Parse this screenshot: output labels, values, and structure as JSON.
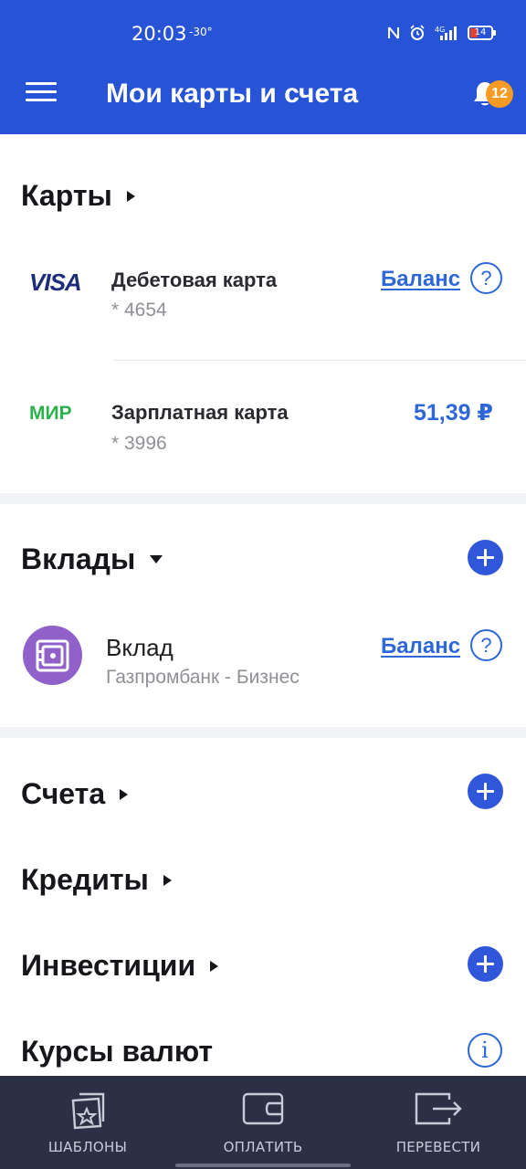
{
  "status_bar": {
    "time": "20:03",
    "temperature": "-30°",
    "battery": "14"
  },
  "header": {
    "title": "Мои карты и счета",
    "notifications_count": "12"
  },
  "cards_section": {
    "title": "Карты",
    "items": [
      {
        "brand": "VISA",
        "name": "Дебетовая карта",
        "number": "* 4654",
        "balance_link": "Баланс",
        "help": "?"
      },
      {
        "brand": "МИР",
        "name": "Зарплатная карта",
        "number": "* 3996",
        "amount": "51,39 ₽"
      }
    ]
  },
  "deposits_section": {
    "title": "Вклады",
    "items": [
      {
        "name": "Вклад",
        "bank": "Газпромбанк - Бизнес",
        "balance_link": "Баланс",
        "help": "?"
      }
    ]
  },
  "other_sections": {
    "accounts": "Счета",
    "credits": "Кредиты",
    "investments": "Инвестиции",
    "currency_rates": "Курсы валют",
    "info_symbol": "i"
  },
  "bottom_nav": {
    "templates": "ШАБЛОНЫ",
    "pay": "ОПЛАТИТЬ",
    "transfer": "ПЕРЕВЕСТИ"
  },
  "colors": {
    "primary": "#2754d6",
    "link": "#2d67d8",
    "badge": "#f59a23",
    "nav_bg": "#2b3045",
    "vault": "#8f61c9",
    "mir_green": "#2bb24c"
  }
}
